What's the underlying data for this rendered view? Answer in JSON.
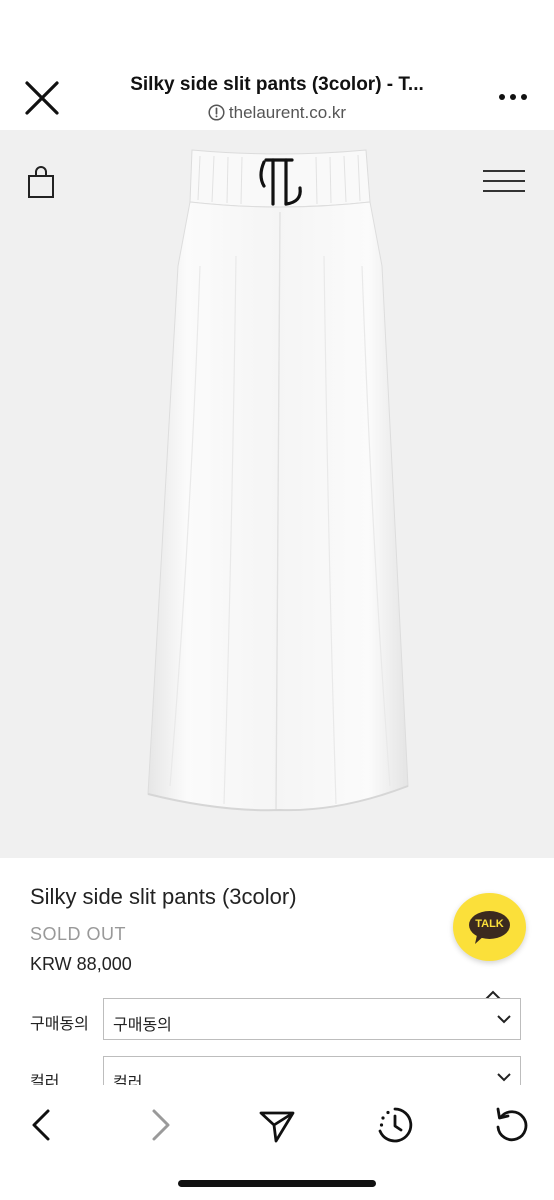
{
  "browser": {
    "title": "Silky side slit pants (3color) - T...",
    "url": "thelaurent.co.kr"
  },
  "hero": {
    "logo_text": "TL",
    "image_alt": "white wide-leg silky pants"
  },
  "product": {
    "name": "Silky side slit pants (3color)",
    "status": "SOLD OUT",
    "price": "KRW 88,000"
  },
  "kakao": {
    "label": "TALK",
    "color": "#fbe03a"
  },
  "options": [
    {
      "label": "구매동의",
      "value": "구매동의"
    },
    {
      "label": "컬러",
      "value": "컬러"
    }
  ],
  "icons": {
    "close": "close-icon",
    "more": "more-icon",
    "info": "info-icon",
    "bag": "shopping-bag-icon",
    "menu": "hamburger-menu-icon",
    "back": "chevron-left-icon",
    "forward": "chevron-right-icon",
    "share": "send-icon",
    "history": "history-icon",
    "reload": "reload-icon"
  },
  "colors": {
    "hero_bg": "#f0f0f0",
    "sold_out": "#999999"
  }
}
